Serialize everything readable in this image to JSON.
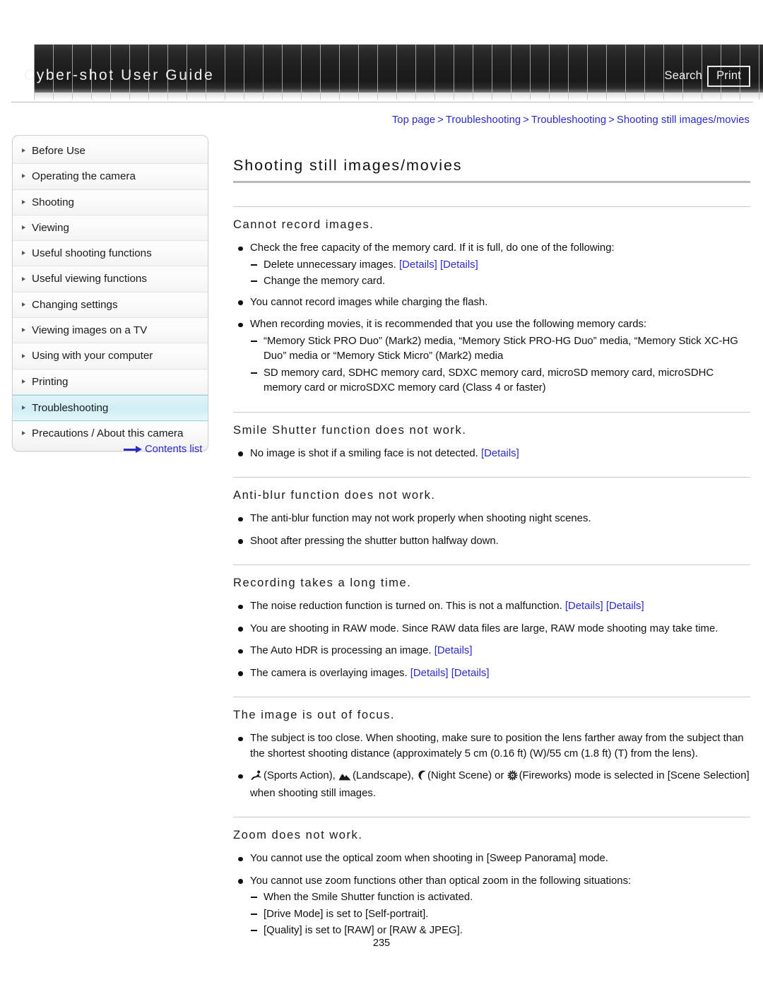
{
  "header": {
    "title": "Cyber-shot User Guide",
    "search_label": "Search",
    "print_label": "Print"
  },
  "breadcrumb": {
    "items": [
      "Top page",
      "Troubleshooting",
      "Troubleshooting",
      "Shooting still images/movies"
    ],
    "separator": ">"
  },
  "sidebar": {
    "items": [
      {
        "label": "Before Use",
        "active": false
      },
      {
        "label": "Operating the camera",
        "active": false
      },
      {
        "label": "Shooting",
        "active": false
      },
      {
        "label": "Viewing",
        "active": false
      },
      {
        "label": "Useful shooting functions",
        "active": false
      },
      {
        "label": "Useful viewing functions",
        "active": false
      },
      {
        "label": "Changing settings",
        "active": false
      },
      {
        "label": "Viewing images on a TV",
        "active": false
      },
      {
        "label": "Using with your computer",
        "active": false
      },
      {
        "label": "Printing",
        "active": false
      },
      {
        "label": "Troubleshooting",
        "active": true
      },
      {
        "label": "Precautions / About this camera",
        "active": false
      }
    ],
    "contents_list_label": "Contents list"
  },
  "main": {
    "page_title": "Shooting still images/movies",
    "sections": [
      {
        "title": "Cannot record images.",
        "bullets": [
          {
            "text": "Check the free capacity of the memory card. If it is full, do one of the following:",
            "sub": [
              {
                "text": "Delete unnecessary images.",
                "links": [
                  "[Details]",
                  "[Details]"
                ]
              },
              {
                "text": "Change the memory card.",
                "links": []
              }
            ]
          },
          {
            "text": "You cannot record images while charging the flash.",
            "sub": []
          },
          {
            "text": "When recording movies, it is recommended that you use the following memory cards:",
            "sub": [
              {
                "text": "“Memory Stick PRO Duo” (Mark2) media, “Memory Stick PRO-HG Duo” media, “Memory Stick XC-HG Duo” media or “Memory Stick Micro” (Mark2) media",
                "links": []
              },
              {
                "text": "SD memory card, SDHC memory card, SDXC memory card, microSD memory card, microSDHC memory card or microSDXC memory card (Class 4 or faster)",
                "links": []
              }
            ]
          }
        ]
      },
      {
        "title": "Smile Shutter function does not work.",
        "bullets": [
          {
            "text": "No image is shot if a smiling face is not detected.",
            "links": [
              "[Details]"
            ],
            "sub": []
          }
        ]
      },
      {
        "title": "Anti-blur function does not work.",
        "bullets": [
          {
            "text": "The anti-blur function may not work properly when shooting night scenes.",
            "sub": []
          },
          {
            "text": "Shoot after pressing the shutter button halfway down.",
            "sub": []
          }
        ]
      },
      {
        "title": "Recording takes a long time.",
        "bullets": [
          {
            "text": "The noise reduction function is turned on. This is not a malfunction.",
            "links": [
              "[Details]",
              "[Details]"
            ],
            "sub": []
          },
          {
            "text": "You are shooting in RAW mode. Since RAW data files are large, RAW mode shooting may take time.",
            "sub": []
          },
          {
            "text": "The Auto HDR is processing an image.",
            "links": [
              "[Details]"
            ],
            "sub": []
          },
          {
            "text": "The camera is overlaying images.",
            "links": [
              "[Details]",
              "[Details]"
            ],
            "sub": []
          }
        ]
      },
      {
        "title": "The image is out of focus.",
        "bullets": [
          {
            "text": "The subject is too close. When shooting, make sure to position the lens farther away from the subject than the shortest shooting distance (approximately 5 cm (0.16 ft) (W)/55 cm (1.8 ft) (T) from the lens).",
            "sub": []
          },
          {
            "icon_mode_text_a": "(Sports Action),",
            "icon_mode_text_b": "(Landscape),",
            "icon_mode_text_c": "(Night Scene) or",
            "icon_mode_text_d": "(Fireworks) mode is selected in [Scene Selection] when shooting still images.",
            "sub": []
          }
        ]
      },
      {
        "title": "Zoom does not work.",
        "bullets": [
          {
            "text": "You cannot use the optical zoom when shooting in [Sweep Panorama] mode.",
            "sub": []
          },
          {
            "text": "You cannot use zoom functions other than optical zoom in the following situations:",
            "sub": [
              {
                "text": "When the Smile Shutter function is activated.",
                "links": []
              },
              {
                "text": "[Drive Mode] is set to [Self-portrait].",
                "links": []
              },
              {
                "text": "[Quality] is set to [RAW] or [RAW & JPEG].",
                "links": []
              }
            ]
          }
        ]
      }
    ]
  },
  "footer": {
    "page_number": "235"
  },
  "colors": {
    "link": "#2b2bc8",
    "active_nav": "#cfeef5",
    "header_dark": "#1a1a1a"
  }
}
